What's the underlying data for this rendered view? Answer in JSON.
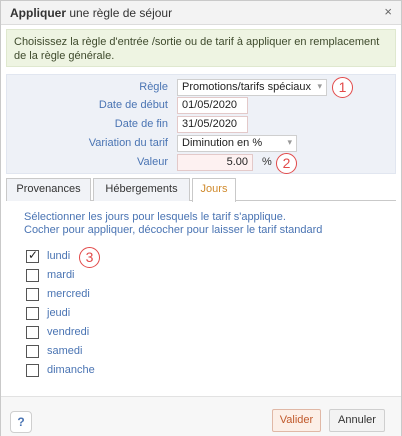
{
  "window": {
    "title_strong": "Appliquer",
    "title_rest": " une règle de séjour",
    "close_glyph": "×"
  },
  "info": {
    "text": "Choisissez la règle d'entrée /sortie ou de tarif à appliquer en remplacement de la règle générale."
  },
  "form": {
    "regle_label": "Règle",
    "regle_value": "Promotions/tarifs spéciaux",
    "date_debut_label": "Date de début",
    "date_debut_value": "01/05/2020",
    "date_fin_label": "Date de fin",
    "date_fin_value": "31/05/2020",
    "variation_label": "Variation du tarif",
    "variation_value": "Diminution en %",
    "valeur_label": "Valeur",
    "valeur_value": "5.00",
    "valeur_unit": "%"
  },
  "markers": [
    "1",
    "2",
    "3"
  ],
  "tabs": [
    {
      "label": "Provenances",
      "active": false
    },
    {
      "label": "Hébergements",
      "active": false
    },
    {
      "label": "Jours",
      "active": true
    }
  ],
  "jours": {
    "instruction_line1": "Sélectionner les jours pour lesquels le tarif s'applique.",
    "instruction_line2": "Cocher pour appliquer, décocher pour laisser le tarif standard",
    "days": [
      {
        "label": "lundi",
        "checked": true
      },
      {
        "label": "mardi",
        "checked": false
      },
      {
        "label": "mercredi",
        "checked": false
      },
      {
        "label": "jeudi",
        "checked": false
      },
      {
        "label": "vendredi",
        "checked": false
      },
      {
        "label": "samedi",
        "checked": false
      },
      {
        "label": "dimanche",
        "checked": false
      }
    ]
  },
  "footer": {
    "help_label": "?",
    "valider_label": "Valider",
    "annuler_label": "Annuler"
  },
  "colors": {
    "accent_orange": "#d08a2c",
    "link_blue": "#4a74b3",
    "marker_red": "#e24a4a",
    "info_green_bg": "#eef4e2"
  }
}
